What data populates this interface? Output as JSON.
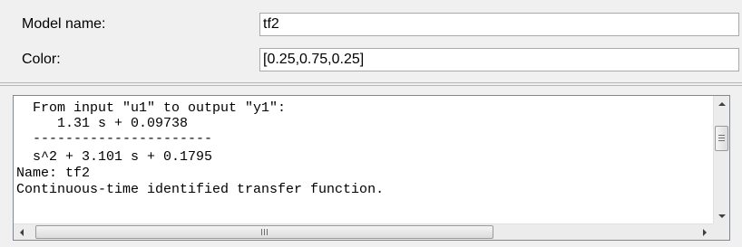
{
  "form": {
    "model_name_label": "Model name:",
    "model_name_value": "tf2",
    "color_label": "Color:",
    "color_value": "[0.25,0.75,0.25]"
  },
  "output_pane": {
    "lines": [
      "  From input \"u1\" to output \"y1\":",
      "     1.31 s + 0.09738",
      "  ----------------------",
      "  s^2 + 3.101 s + 0.1795",
      "Name: tf2",
      "Continuous-time identified transfer function."
    ]
  },
  "icons": {
    "scroll_up": "arrow-up-icon",
    "scroll_down": "arrow-down-icon",
    "scroll_left": "arrow-left-icon",
    "scroll_right": "arrow-right-icon"
  }
}
